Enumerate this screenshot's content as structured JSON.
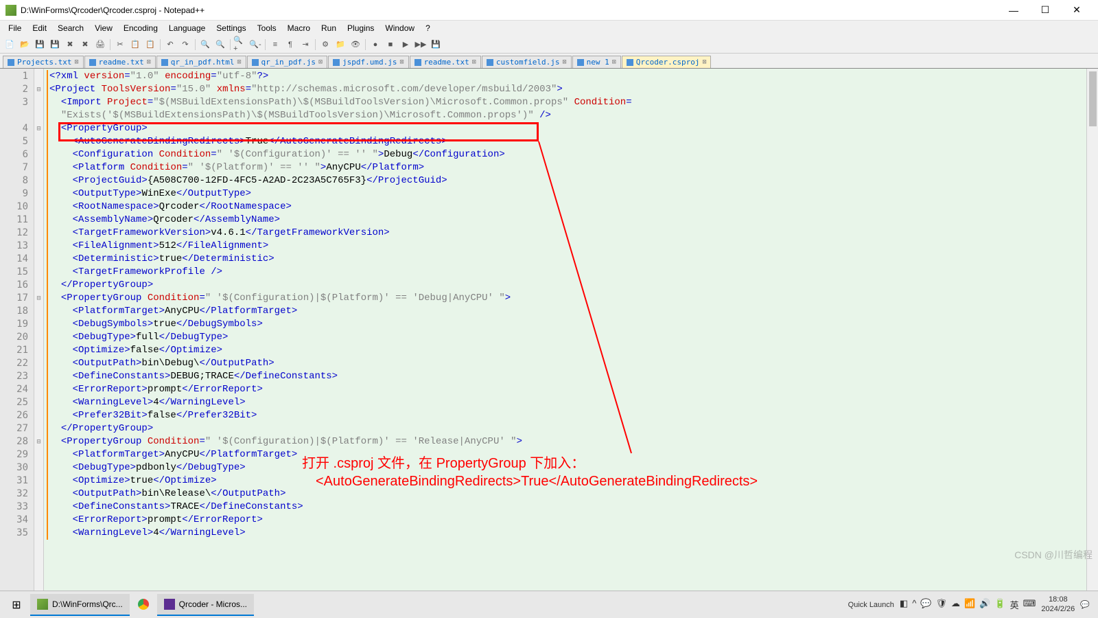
{
  "titlebar": {
    "title": "D:\\WinForms\\Qrcoder\\Qrcoder.csproj - Notepad++"
  },
  "menubar": {
    "items": [
      "File",
      "Edit",
      "Search",
      "View",
      "Encoding",
      "Language",
      "Settings",
      "Tools",
      "Macro",
      "Run",
      "Plugins",
      "Window",
      "?"
    ]
  },
  "tabs": [
    {
      "label": "Projects.txt",
      "active": false
    },
    {
      "label": "readme.txt",
      "active": false
    },
    {
      "label": "qr_in_pdf.html",
      "active": false
    },
    {
      "label": "qr_in_pdf.js",
      "active": false
    },
    {
      "label": "jspdf.umd.js",
      "active": false
    },
    {
      "label": "readme.txt",
      "active": false
    },
    {
      "label": "customfield.js",
      "active": false
    },
    {
      "label": "new 1",
      "active": false
    },
    {
      "label": "Qrcoder.csproj",
      "active": true
    }
  ],
  "code_lines": [
    {
      "n": 1,
      "fold": "",
      "html": "<span class='t-blue'>&lt;?xml</span> <span class='t-red'>version</span><span class='t-blue'>=</span><span class='t-gray'>\"1.0\"</span> <span class='t-red'>encoding</span><span class='t-blue'>=</span><span class='t-gray'>\"utf-8\"</span><span class='t-blue'>?&gt;</span>"
    },
    {
      "n": 2,
      "fold": "⊟",
      "html": "<span class='t-blue'>&lt;Project</span> <span class='t-red'>ToolsVersion</span><span class='t-blue'>=</span><span class='t-gray'>\"15.0\"</span> <span class='t-red'>xmlns</span><span class='t-blue'>=</span><span class='t-gray'>\"http://schemas.microsoft.com/developer/msbuild/2003\"</span><span class='t-blue'>&gt;</span>"
    },
    {
      "n": 3,
      "fold": "",
      "html": "  <span class='t-blue'>&lt;Import</span> <span class='t-red'>Project</span><span class='t-blue'>=</span><span class='t-gray'>\"$(MSBuildExtensionsPath)\\$(MSBuildToolsVersion)\\Microsoft.Common.props\"</span> <span class='t-red'>Condition</span><span class='t-blue'>=</span>"
    },
    {
      "n": "",
      "fold": "",
      "html": "  <span class='t-gray'>\"Exists('$(MSBuildExtensionsPath)\\$(MSBuildToolsVersion)\\Microsoft.Common.props')\"</span> <span class='t-blue'>/&gt;</span>"
    },
    {
      "n": 4,
      "fold": "⊟",
      "html": "  <span class='t-blue'>&lt;PropertyGroup&gt;</span>"
    },
    {
      "n": 5,
      "fold": "",
      "html": "    <span class='t-blue'>&lt;AutoGenerateBindingRedirects&gt;</span>True<span class='t-blue'>&lt;/AutoGenerateBindingRedirects&gt;</span>"
    },
    {
      "n": 6,
      "fold": "",
      "html": "    <span class='t-blue'>&lt;Configuration</span> <span class='t-red'>Condition</span><span class='t-blue'>=</span><span class='t-gray'>\" '$(Configuration)' == '' \"</span><span class='t-blue'>&gt;</span>Debug<span class='t-blue'>&lt;/Configuration&gt;</span>"
    },
    {
      "n": 7,
      "fold": "",
      "html": "    <span class='t-blue'>&lt;Platform</span> <span class='t-red'>Condition</span><span class='t-blue'>=</span><span class='t-gray'>\" '$(Platform)' == '' \"</span><span class='t-blue'>&gt;</span>AnyCPU<span class='t-blue'>&lt;/Platform&gt;</span>"
    },
    {
      "n": 8,
      "fold": "",
      "html": "    <span class='t-blue'>&lt;ProjectGuid&gt;</span>{A508C700-12FD-4FC5-A2AD-2C23A5C765F3}<span class='t-blue'>&lt;/ProjectGuid&gt;</span>"
    },
    {
      "n": 9,
      "fold": "",
      "html": "    <span class='t-blue'>&lt;OutputType&gt;</span>WinExe<span class='t-blue'>&lt;/OutputType&gt;</span>"
    },
    {
      "n": 10,
      "fold": "",
      "html": "    <span class='t-blue'>&lt;RootNamespace&gt;</span>Qrcoder<span class='t-blue'>&lt;/RootNamespace&gt;</span>"
    },
    {
      "n": 11,
      "fold": "",
      "html": "    <span class='t-blue'>&lt;AssemblyName&gt;</span>Qrcoder<span class='t-blue'>&lt;/AssemblyName&gt;</span>"
    },
    {
      "n": 12,
      "fold": "",
      "html": "    <span class='t-blue'>&lt;TargetFrameworkVersion&gt;</span>v4.6.1<span class='t-blue'>&lt;/TargetFrameworkVersion&gt;</span>"
    },
    {
      "n": 13,
      "fold": "",
      "html": "    <span class='t-blue'>&lt;FileAlignment&gt;</span>512<span class='t-blue'>&lt;/FileAlignment&gt;</span>"
    },
    {
      "n": 14,
      "fold": "",
      "html": "    <span class='t-blue'>&lt;Deterministic&gt;</span>true<span class='t-blue'>&lt;/Deterministic&gt;</span>"
    },
    {
      "n": 15,
      "fold": "",
      "html": "    <span class='t-blue'>&lt;TargetFrameworkProfile /&gt;</span>"
    },
    {
      "n": 16,
      "fold": "",
      "html": "  <span class='t-blue'>&lt;/PropertyGroup&gt;</span>"
    },
    {
      "n": 17,
      "fold": "⊟",
      "html": "  <span class='t-blue'>&lt;PropertyGroup</span> <span class='t-red'>Condition</span><span class='t-blue'>=</span><span class='t-gray'>\" '$(Configuration)|$(Platform)' == 'Debug|AnyCPU' \"</span><span class='t-blue'>&gt;</span>"
    },
    {
      "n": 18,
      "fold": "",
      "html": "    <span class='t-blue'>&lt;PlatformTarget&gt;</span>AnyCPU<span class='t-blue'>&lt;/PlatformTarget&gt;</span>"
    },
    {
      "n": 19,
      "fold": "",
      "html": "    <span class='t-blue'>&lt;DebugSymbols&gt;</span>true<span class='t-blue'>&lt;/DebugSymbols&gt;</span>"
    },
    {
      "n": 20,
      "fold": "",
      "html": "    <span class='t-blue'>&lt;DebugType&gt;</span>full<span class='t-blue'>&lt;/DebugType&gt;</span>"
    },
    {
      "n": 21,
      "fold": "",
      "html": "    <span class='t-blue'>&lt;Optimize&gt;</span>false<span class='t-blue'>&lt;/Optimize&gt;</span>"
    },
    {
      "n": 22,
      "fold": "",
      "html": "    <span class='t-blue'>&lt;OutputPath&gt;</span>bin\\Debug\\<span class='t-blue'>&lt;/OutputPath&gt;</span>"
    },
    {
      "n": 23,
      "fold": "",
      "html": "    <span class='t-blue'>&lt;DefineConstants&gt;</span>DEBUG;TRACE<span class='t-blue'>&lt;/DefineConstants&gt;</span>"
    },
    {
      "n": 24,
      "fold": "",
      "html": "    <span class='t-blue'>&lt;ErrorReport&gt;</span>prompt<span class='t-blue'>&lt;/ErrorReport&gt;</span>"
    },
    {
      "n": 25,
      "fold": "",
      "html": "    <span class='t-blue'>&lt;WarningLevel&gt;</span>4<span class='t-blue'>&lt;/WarningLevel&gt;</span>"
    },
    {
      "n": 26,
      "fold": "",
      "html": "    <span class='t-blue'>&lt;Prefer32Bit&gt;</span>false<span class='t-blue'>&lt;/Prefer32Bit&gt;</span>"
    },
    {
      "n": 27,
      "fold": "",
      "html": "  <span class='t-blue'>&lt;/PropertyGroup&gt;</span>"
    },
    {
      "n": 28,
      "fold": "⊟",
      "html": "  <span class='t-blue'>&lt;PropertyGroup</span> <span class='t-red'>Condition</span><span class='t-blue'>=</span><span class='t-gray'>\" '$(Configuration)|$(Platform)' == 'Release|AnyCPU' \"</span><span class='t-blue'>&gt;</span>"
    },
    {
      "n": 29,
      "fold": "",
      "html": "    <span class='t-blue'>&lt;PlatformTarget&gt;</span>AnyCPU<span class='t-blue'>&lt;/PlatformTarget&gt;</span>"
    },
    {
      "n": 30,
      "fold": "",
      "html": "    <span class='t-blue'>&lt;DebugType&gt;</span>pdbonly<span class='t-blue'>&lt;/DebugType&gt;</span>"
    },
    {
      "n": 31,
      "fold": "",
      "html": "    <span class='t-blue'>&lt;Optimize&gt;</span>true<span class='t-blue'>&lt;/Optimize&gt;</span>"
    },
    {
      "n": 32,
      "fold": "",
      "html": "    <span class='t-blue'>&lt;OutputPath&gt;</span>bin\\Release\\<span class='t-blue'>&lt;/OutputPath&gt;</span>"
    },
    {
      "n": 33,
      "fold": "",
      "html": "    <span class='t-blue'>&lt;DefineConstants&gt;</span>TRACE<span class='t-blue'>&lt;/DefineConstants&gt;</span>"
    },
    {
      "n": 34,
      "fold": "",
      "html": "    <span class='t-blue'>&lt;ErrorReport&gt;</span>prompt<span class='t-blue'>&lt;/ErrorReport&gt;</span>"
    },
    {
      "n": 35,
      "fold": "",
      "html": "    <span class='t-blue'>&lt;WarningLevel&gt;</span>4<span class='t-blue'>&lt;/WarningLevel&gt;</span>"
    }
  ],
  "annotation": {
    "line1": "打开 .csproj 文件，在 PropertyGroup 下加入：",
    "line2": "<AutoGenerateBindingRedirects>True</AutoGenerateBindingRedirects>"
  },
  "taskbar": {
    "items": [
      {
        "label": "D:\\WinForms\\Qrc...",
        "icon": "notepadpp"
      },
      {
        "label": "",
        "icon": "chrome"
      },
      {
        "label": "Qrcoder - Micros...",
        "icon": "vs"
      }
    ],
    "quick_launch": "Quick Launch",
    "time": "18:08",
    "date": "2024/2/26",
    "ime": "英"
  },
  "watermark": "CSDN @川哲编程"
}
